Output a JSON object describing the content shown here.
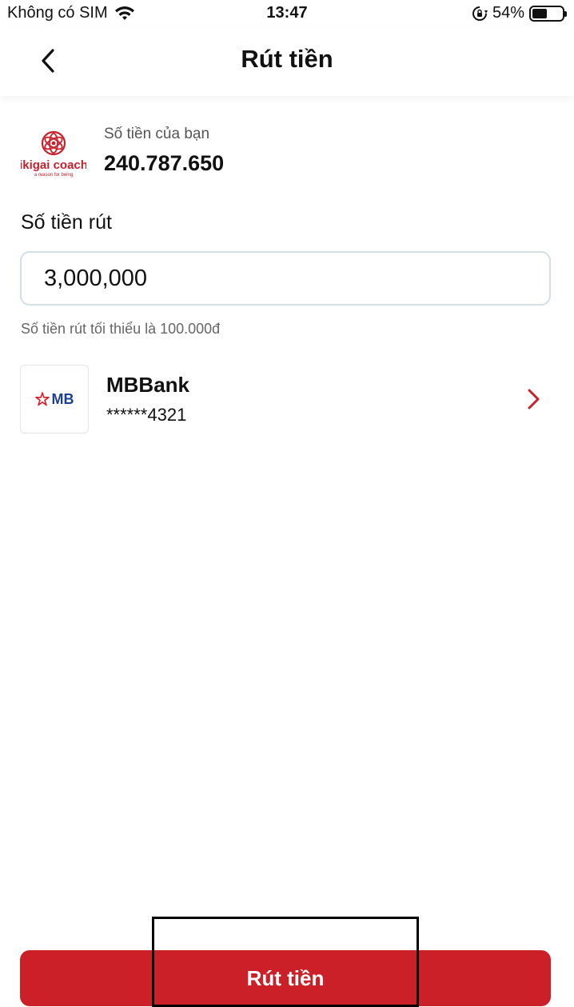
{
  "status_bar": {
    "carrier": "Không có SIM",
    "time": "13:47",
    "battery": "54%",
    "icons": [
      "wifi-icon",
      "orientation-lock-icon",
      "battery-icon"
    ]
  },
  "header": {
    "title": "Rút tiền",
    "back_icon": "chevron-left-icon"
  },
  "balance": {
    "logo_brand": "ikigai coach",
    "logo_tagline": "a reason for being",
    "label": "Số tiền của bạn",
    "value": "240.787.650"
  },
  "withdraw": {
    "amount_label": "Số tiền rút",
    "amount_value": "3,000,000",
    "hint": "Số tiền rút tối thiểu là 100.000đ"
  },
  "bank": {
    "logo_text": "MB",
    "name": "MBBank",
    "account": "******4321",
    "chevron_icon": "chevron-right-icon"
  },
  "submit": {
    "label": "Rút tiền"
  },
  "colors": {
    "accent": "#cc2028",
    "bank_blue": "#1d3f8f",
    "input_border": "#d6dde6"
  }
}
